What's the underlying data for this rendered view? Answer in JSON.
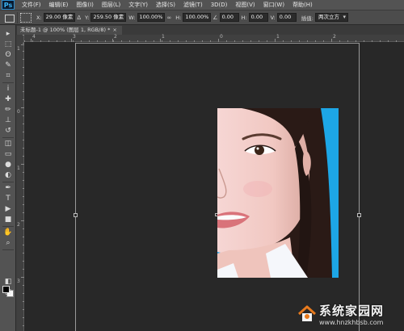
{
  "app": {
    "logo": "Ps"
  },
  "menu": [
    "文件(F)",
    "编辑(E)",
    "图像(I)",
    "图层(L)",
    "文字(Y)",
    "选择(S)",
    "滤镜(T)",
    "3D(D)",
    "视图(V)",
    "窗口(W)",
    "帮助(H)"
  ],
  "options": {
    "x_label": "X:",
    "x_value": "29.00 像素",
    "y_label": "Y:",
    "y_value": "259.50 像素",
    "w_label": "W:",
    "w_value": "100.00%",
    "h_label": "H:",
    "h_value": "100.00%",
    "angle_value": "0.00",
    "hskew_label": "H:",
    "hskew_value": "0.00",
    "vskew_label": "V:",
    "vskew_value": "0.00",
    "interp_label": "插值:",
    "interp_value": "两次立方"
  },
  "document": {
    "tab_title": "未标题-1 @ 100% (图层 1, RGB/8) *",
    "close_glyph": "×"
  },
  "rulers": {
    "top": [
      "4",
      "3",
      "2",
      "1",
      "0",
      "1",
      "2"
    ],
    "left": [
      "1",
      "0",
      "1",
      "2",
      "3"
    ]
  },
  "icons": {
    "tools": [
      "move-icon",
      "marquee-icon",
      "lasso-icon",
      "quick-select-icon",
      "crop-icon",
      "eyedropper-icon",
      "healing-brush-icon",
      "brush-icon",
      "clone-stamp-icon",
      "history-brush-icon",
      "eraser-icon",
      "gradient-icon",
      "blur-icon",
      "dodge-icon",
      "pen-icon",
      "type-icon",
      "path-select-icon",
      "rectangle-icon",
      "hand-icon",
      "zoom-icon",
      "quick-mask-icon",
      "screen-mode-icon"
    ]
  },
  "colors": {
    "foreground": "#000000",
    "background": "#ffffff",
    "photo_bg": "#1da6e6",
    "accent": "#e87a1d"
  },
  "watermark": {
    "name": "系统家园网",
    "url": "www.hnzkhbsb.com"
  }
}
